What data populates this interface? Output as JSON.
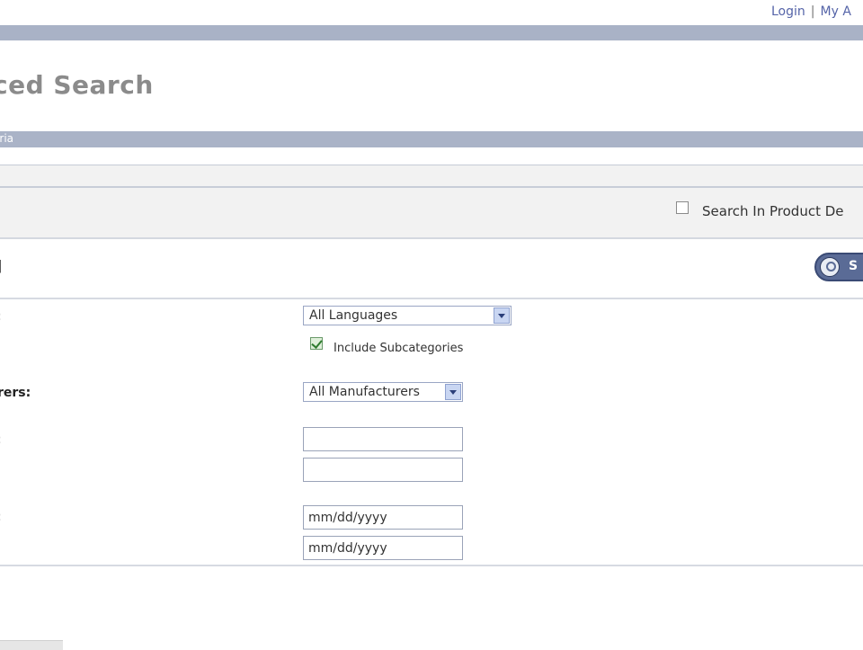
{
  "header": {
    "login_link": "Login",
    "separator": "|",
    "account_link": "My A"
  },
  "page": {
    "title": "ced Search"
  },
  "criteria_section": {
    "title": "eria"
  },
  "keywords": {
    "search_in_description_label": "Search In Product De",
    "search_in_description_checked": false
  },
  "help_bracket": "]",
  "search_button": {
    "icon": "magnifier-icon",
    "label": "S"
  },
  "form": {
    "language_label": ":",
    "language_select_value": "All Languages",
    "include_subcategories_label": "Include Subcategories",
    "include_subcategories_checked": true,
    "manufacturers_label": "rers:",
    "manufacturers_select_value": "All Manufacturers",
    "price_label": ":",
    "price_from_value": "",
    "price_to_value": "",
    "date_label": ":",
    "date_from_value": "mm/dd/yyyy",
    "date_to_value": "mm/dd/yyyy"
  }
}
